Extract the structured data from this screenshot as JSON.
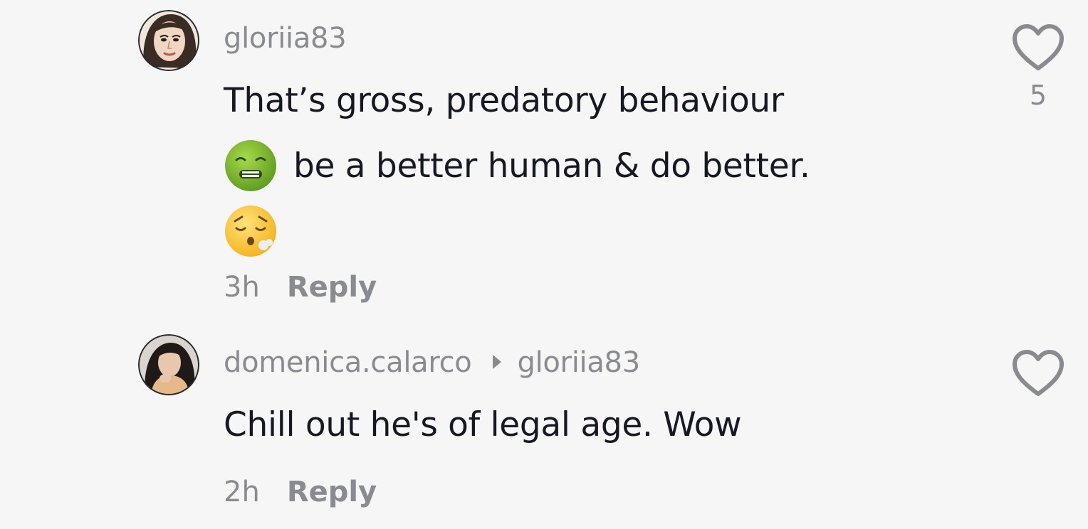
{
  "comments": [
    {
      "username": "gloriia83",
      "avatar": "woman-portrait-illustration",
      "text_lines": [
        {
          "text": "That’s gross, predatory behaviour",
          "leading_emoji": null
        },
        {
          "text": "be a better human & do better.",
          "leading_emoji": "nauseated-face-emoji"
        },
        {
          "text": "",
          "leading_emoji": "face-exhaling-emoji"
        }
      ],
      "time": "3h",
      "reply_label": "Reply",
      "like_icon": "heart-outline-icon",
      "like_count": "5"
    },
    {
      "username": "domenica.calarco",
      "reply_to_icon": "play-triangle-icon",
      "reply_to": "gloriia83",
      "avatar": "woman-photo",
      "text_lines": [
        {
          "text": "Chill out he's of legal age. Wow",
          "leading_emoji": null
        }
      ],
      "time": "2h",
      "reply_label": "Reply",
      "like_icon": "heart-outline-icon",
      "like_count": ""
    }
  ],
  "colors": {
    "background": "#f6f6f6",
    "text": "#161823",
    "muted": "#8a8b91"
  }
}
